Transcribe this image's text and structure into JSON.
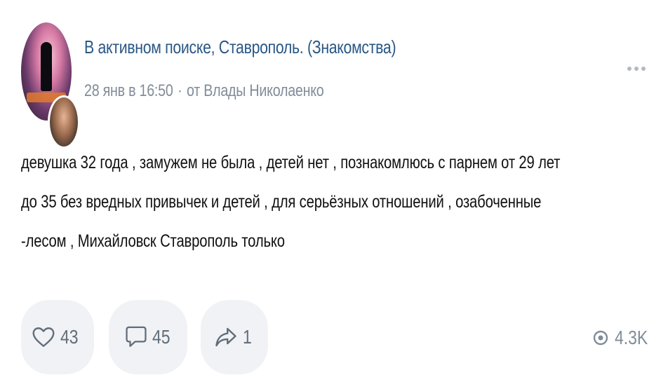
{
  "post": {
    "group_name": "В активном поиске, Ставрополь. (Знакомства)",
    "date": "28 янв в 16:50",
    "separator": "·",
    "author": "от Влады Николаенко",
    "text_lines": [
      "девушка 32 года , замужем не была , детей нет , познакомлюсь с парнем от 29 лет",
      "до 35 без вредных привычек и детей , для серьёзных отношений , озабоченные",
      "-лесом , Михайловск Ставрополь только"
    ],
    "likes": "43",
    "comments": "45",
    "shares": "1",
    "views": "4.3K"
  },
  "icons": {
    "more": "more-dots-icon",
    "like": "heart-icon",
    "comment": "comment-bubble-icon",
    "share": "share-arrow-icon",
    "views": "eye-icon"
  },
  "colors": {
    "link": "#2a5885",
    "secondary": "#818c99",
    "button_bg": "#f0f2f5",
    "icon": "#626d7a"
  }
}
